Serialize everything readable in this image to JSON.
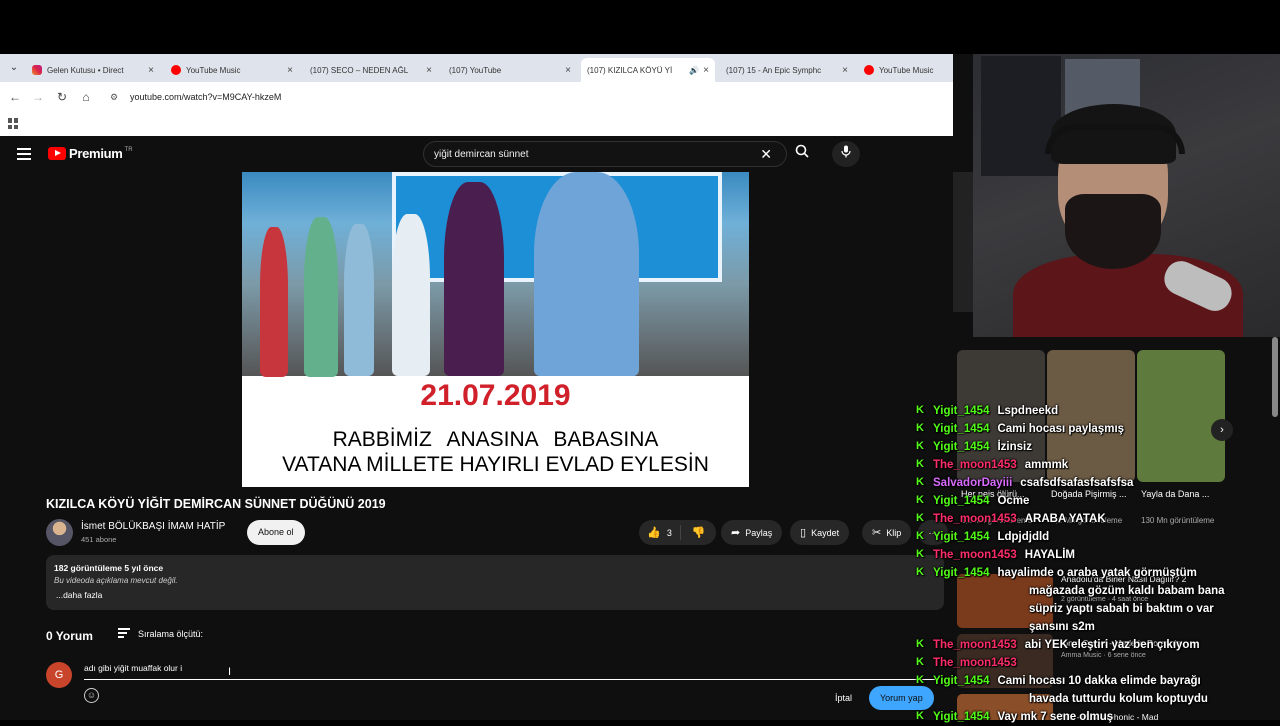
{
  "browser": {
    "tabs": [
      {
        "title": "Gelen Kutusu • Direct",
        "icon": "instagram",
        "active": false
      },
      {
        "title": "YouTube Music",
        "icon": "youtube-music",
        "active": false
      },
      {
        "title": "(107) SECO – NEDEN AĞL",
        "icon": "youtube",
        "active": false
      },
      {
        "title": "(107) YouTube",
        "icon": "youtube",
        "active": false
      },
      {
        "title": "(107) KIZILCA KÖYÜ Yİ",
        "icon": "youtube",
        "active": true
      },
      {
        "title": "(107) 15 - An Epic Symphc",
        "icon": "youtube",
        "active": false
      },
      {
        "title": "YouTube Music",
        "icon": "youtube-music",
        "active": false
      }
    ],
    "url": "youtube.com/watch?v=M9CAY-hkzeM"
  },
  "youtube": {
    "logo_text": "Premium",
    "logo_badge": "TR",
    "search_query": "yiğit demircan sünnet",
    "video_overlay": {
      "date": "21.07.2019",
      "line1": "RABBİMİZ    ANASINA BABASINA",
      "line2": "VATANA MİLLETE HAYIRLI EVLAD EYLESİN"
    },
    "title": "KIZILCA KÖYÜ YİĞİT DEMİRCAN SÜNNET DÜĞÜNÜ 2019",
    "channel": {
      "name": "İsmet BÖLÜKBAŞI İMAM HATİP",
      "subscribers": "451 abone"
    },
    "subscribe_label": "Abone ol",
    "actions": {
      "likes": "3",
      "share": "Paylaş",
      "save": "Kaydet",
      "clip": "Klip",
      "more": "···"
    },
    "description": {
      "views": "182 görüntüleme  5 yıl önce",
      "text": "Bu videoda açıklama mevcut değil.",
      "more": "...daha fazla"
    },
    "comments": {
      "count": "0 Yorum",
      "sort_label": "Sıralama ölçütü:",
      "avatar_letter": "G",
      "draft": "adı gibi yiğit muaffak olur i",
      "cancel": "İptal",
      "submit": "Yorum yap"
    }
  },
  "sidebar": {
    "shorts": [
      {
        "title": "Her neis ölürü...",
        "views": "1,1 Mn görüntüleme",
        "color": "#3d3a36"
      },
      {
        "title": "Doğada Pişirmiş ...",
        "views": "2,1 Mn görüntüleme",
        "color": "#6b5a44"
      },
      {
        "title": "Yayla da Dana ...",
        "views": "130 Mn görüntüleme",
        "color": "#5e7a3c"
      }
    ],
    "recommended": [
      {
        "title": "Anadolu'da Birler Nasıl Dağılır? 2",
        "meta": "2 görüntüleme · 4 saat önce",
        "color": "#7a3a1c"
      },
      {
        "title": "Ionut Cercel - Made in Romania",
        "meta": "Amma Music · 6 sene önce",
        "color": "#3a2a22"
      },
      {
        "title": "Mix - Hoovernhonic - Mad",
        "meta": "",
        "color": "#8a4e28"
      }
    ]
  },
  "chat": [
    {
      "user": "Yigit_1454",
      "msg": "Lspdneekd",
      "color": "#53fc18"
    },
    {
      "user": "Yigit_1454",
      "msg": "Cami hocası paylaşmış",
      "color": "#53fc18"
    },
    {
      "user": "Yigit_1454",
      "msg": "İzinsiz",
      "color": "#53fc18"
    },
    {
      "user": "The_moon1453",
      "msg": "ammmk",
      "color": "#ff2d6a"
    },
    {
      "user": "SalvadorDayiii",
      "msg": "csafsdfsafasfsafsfsa",
      "color": "#d96cff"
    },
    {
      "user": "Yigit_1454",
      "msg": "Ocme",
      "color": "#53fc18"
    },
    {
      "user": "The_moon1453",
      "msg": "ARABA YATAK",
      "color": "#ff2d6a"
    },
    {
      "user": "Yigit_1454",
      "msg": "Ldpjdjdld",
      "color": "#53fc18"
    },
    {
      "user": "The_moon1453",
      "msg": "HAYALİM",
      "color": "#ff2d6a"
    },
    {
      "user": "Yigit_1454",
      "msg": "hayalimde o araba yatak görmüştüm",
      "color": "#53fc18"
    },
    {
      "user": "",
      "msg": "mağazada gözüm kaldı babam bana",
      "color": "#53fc18"
    },
    {
      "user": "",
      "msg": "süpriz yaptı sabah bi baktım o var",
      "color": "#53fc18"
    },
    {
      "user": "",
      "msg": "şansını s2m",
      "color": "#53fc18"
    },
    {
      "user": "The_moon1453",
      "msg": "abi YEK eleştiri yaz ben çıkıyom",
      "color": "#ff2d6a"
    },
    {
      "user": "The_moon1453",
      "msg": "",
      "color": "#ff2d6a"
    },
    {
      "user": "Yigit_1454",
      "msg": "Cami hocası 10 dakka elimde bayrağı",
      "color": "#53fc18"
    },
    {
      "user": "",
      "msg": "havada tutturdu kolum koptuydu",
      "color": "#53fc18"
    },
    {
      "user": "Yigit_1454",
      "msg": "Vay mk 7 sene olmuş",
      "color": "#53fc18"
    }
  ]
}
